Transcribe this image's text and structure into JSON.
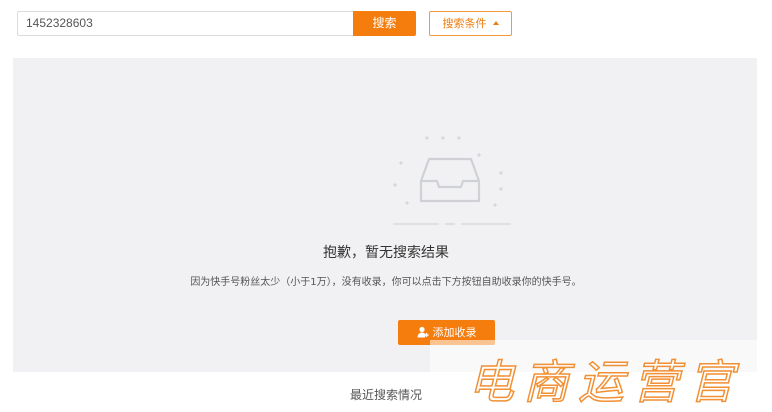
{
  "search": {
    "value": "1452328603",
    "button_label": "搜索",
    "filter_label": "搜索条件"
  },
  "empty_state": {
    "title": "抱歉，暂无搜索结果",
    "description": "因为快手号粉丝太少（小于1万），没有收录，你可以点击下方按钮自助收录你的快手号。",
    "add_button_label": "添加收录"
  },
  "recent": {
    "heading": "最近搜索情况"
  },
  "watermark": {
    "text": "电商运营官"
  },
  "colors": {
    "accent": "#f47d0e",
    "panel_bg": "#f1f1f3"
  },
  "icons": {
    "empty": "empty-inbox-icon",
    "add": "user-add-icon",
    "filter_caret": "caret-up-icon"
  }
}
